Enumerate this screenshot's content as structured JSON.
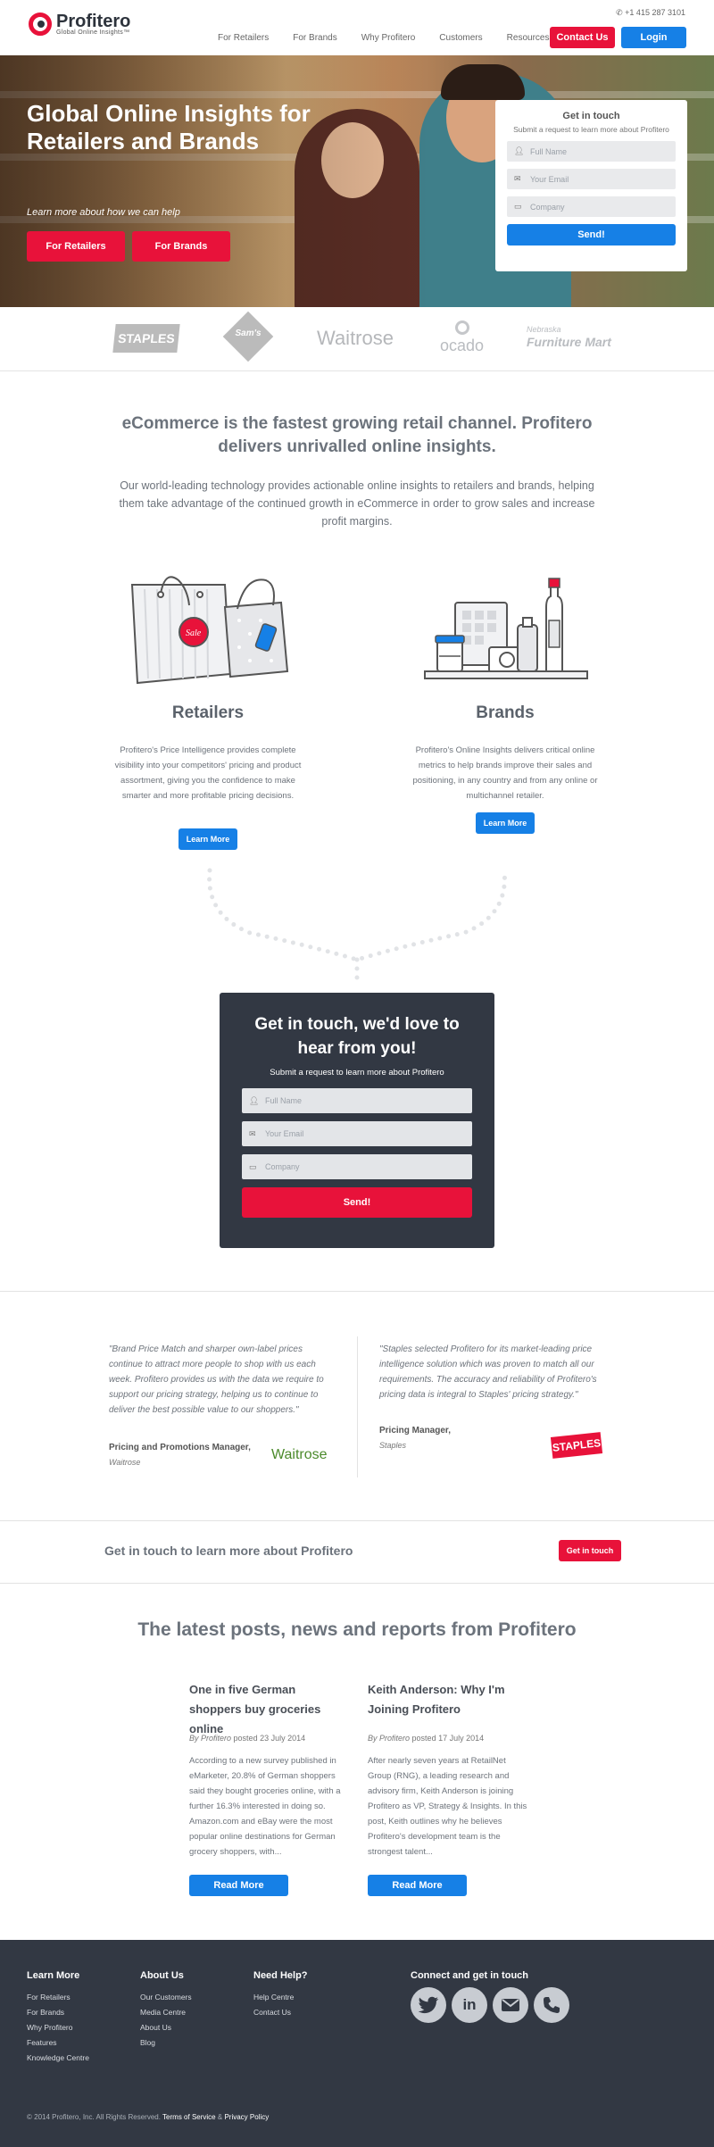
{
  "header": {
    "logo_name": "Profitero",
    "logo_tagline": "Global Online Insights™",
    "phone": "+1 415 287 3101",
    "nav": [
      "For Retailers",
      "For Brands",
      "Why Profitero",
      "Customers",
      "Resources"
    ],
    "contact_label": "Contact Us",
    "login_label": "Login"
  },
  "hero": {
    "title": "Global Online Insights for Retailers and Brands",
    "subtitle": "Learn more about how we can help",
    "btn_retailers": "For Retailers",
    "btn_brands": "For Brands",
    "form": {
      "title": "Get in touch",
      "subtitle": "Submit a request to learn more about Profitero",
      "name_placeholder": "Full Name",
      "email_placeholder": "Your Email",
      "company_placeholder": "Company",
      "send_label": "Send!"
    }
  },
  "logos": {
    "staples": "STAPLES",
    "sams": "Sam's",
    "waitrose": "Waitrose",
    "ocado": "ocado",
    "furniture_top": "Nebraska",
    "furniture_main": "Furniture Mart"
  },
  "intro": {
    "heading": "eCommerce is the fastest growing retail channel. Profitero delivers unrivalled online insights.",
    "body": "Our world-leading technology provides actionable online insights to retailers and brands, helping them take advantage of the continued growth in eCommerce in order to grow sales and increase profit margins."
  },
  "retailers": {
    "heading": "Retailers",
    "body": "Profitero's Price Intelligence provides complete visibility into your competitors' pricing and product assortment, giving you the confidence to make smarter and more profitable pricing decisions.",
    "button": "Learn More",
    "tag_sale": "Sale"
  },
  "brands": {
    "heading": "Brands",
    "body": "Profitero's Online Insights delivers critical online metrics to help brands improve their sales and positioning, in any country and from any online or multichannel retailer.",
    "button": "Learn More"
  },
  "dark_form": {
    "heading": "Get in touch, we'd love to hear from you!",
    "subtitle": "Submit a request to learn more about Profitero",
    "name_placeholder": "Full Name",
    "email_placeholder": "Your Email",
    "company_placeholder": "Company",
    "send_label": "Send!"
  },
  "testimonials": [
    {
      "quote": "\"Brand Price Match and sharper own-label prices continue to attract more people to shop with us each week. Profitero provides us with the data we require to support our pricing strategy, helping us to continue to deliver the best possible value to our shoppers.\"",
      "name": "Pricing and Promotions Manager,",
      "org": "Waitrose",
      "logo": "Waitrose"
    },
    {
      "quote": "\"Staples selected Profitero for its market-leading price intelligence solution which was proven to match all our requirements. The accuracy and reliability of Profitero's pricing data is integral to Staples' pricing strategy.\"",
      "name": "Pricing Manager,",
      "org": "Staples",
      "logo": "STAPLES"
    }
  ],
  "cta": {
    "text": "Get in touch to learn more about Profitero",
    "button": "Get in touch"
  },
  "posts": {
    "heading": "The latest posts, news and reports from Profitero",
    "items": [
      {
        "title": "One in five German shoppers buy groceries online",
        "by": "By Profitero",
        "date": "posted 23 July 2014",
        "body": "According to a new survey published in eMarketer, 20.8% of German shoppers said they bought groceries online, with a further 16.3% interested in doing so. Amazon.com and eBay were the most popular online destinations for German grocery shoppers, with...",
        "button": "Read More"
      },
      {
        "title": "Keith Anderson: Why I'm Joining Profitero",
        "by": "By Profitero",
        "date": "posted 17 July 2014",
        "body": "After nearly seven years at RetailNet Group (RNG), a leading research and advisory firm, Keith Anderson is joining Profitero as VP, Strategy & Insights. In this post, Keith outlines why he believes Profitero's development team is the strongest talent...",
        "button": "Read More"
      }
    ]
  },
  "footer": {
    "learn_more": {
      "heading": "Learn More",
      "links": [
        "For Retailers",
        "For Brands",
        "Why Profitero",
        "Features",
        "Knowledge Centre"
      ]
    },
    "about_us": {
      "heading": "About Us",
      "links": [
        "Our Customers",
        "Media Centre",
        "About Us",
        "Blog"
      ]
    },
    "need_help": {
      "heading": "Need Help?",
      "links": [
        "Help Centre",
        "Contact Us"
      ]
    },
    "connect": {
      "heading": "Connect and get in touch",
      "icons": [
        "twitter-icon",
        "linkedin-icon",
        "email-icon",
        "phone-icon"
      ]
    },
    "copyright": "© 2014 Profitero, Inc. All Rights Reserved.",
    "terms": "Terms of Service",
    "amp": "&",
    "privacy": "Privacy Policy"
  },
  "colors": {
    "red": "#e8123a",
    "blue": "#1680e6",
    "dark": "#323843"
  }
}
